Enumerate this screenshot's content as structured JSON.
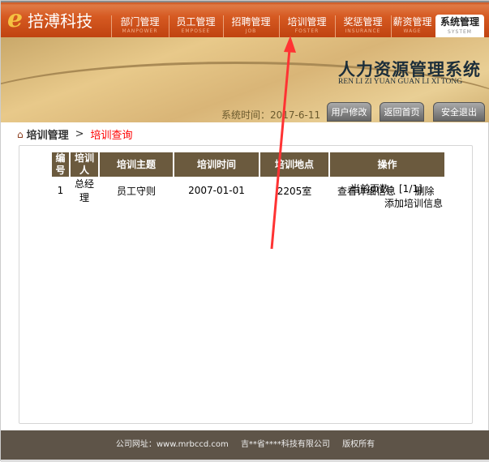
{
  "logo": {
    "text": "staff-logo",
    "name": "onwards",
    "brand": "e",
    "title": "掊溥科技"
  },
  "nav": [
    {
      "zh": "部门管理",
      "en": "MANPOWER"
    },
    {
      "zh": "员工管理",
      "en": "EMPOSEE"
    },
    {
      "zh": "招聘管理",
      "en": "JOB"
    },
    {
      "zh": "培训管理",
      "en": "FOSTER"
    },
    {
      "zh": "奖惩管理",
      "en": "INSURANCE"
    },
    {
      "zh": "薪资管理",
      "en": "WAGE"
    },
    {
      "zh": "系统管理",
      "en": "SYSTEM"
    }
  ],
  "banner": {
    "title": "人力资源管理系统",
    "subtitle": "REN LI ZI YUAN GUAN LI XI TONG",
    "systime": "系统时间：2017-6-11",
    "buttons": [
      "用户修改",
      "返回首页",
      "安全退出"
    ]
  },
  "breadcrumb": {
    "parent": "培训管理",
    "separator": ">",
    "current": "培训查询"
  },
  "table": {
    "headers": [
      "编号",
      "培训人",
      "培训主题",
      "培训时间",
      "培训地点",
      "操作"
    ],
    "rows": [
      {
        "id": "1",
        "person": "总经理",
        "topic": "员工守则",
        "time": "2007-01-01",
        "place": "2205室",
        "view": "查看详细信息",
        "delete": "删除"
      }
    ]
  },
  "pager": "当前页数：[1/1]",
  "add_link": "添加培训信息",
  "footer": {
    "site": "公司网址：www.mrbccd.com",
    "company": "吉**省****科技有限公司",
    "rights": "版权所有"
  },
  "colors": {
    "header": "#6b5a3e",
    "accent": "#d65a22",
    "footer": "#5e5448",
    "annotation": "#ff3333"
  }
}
